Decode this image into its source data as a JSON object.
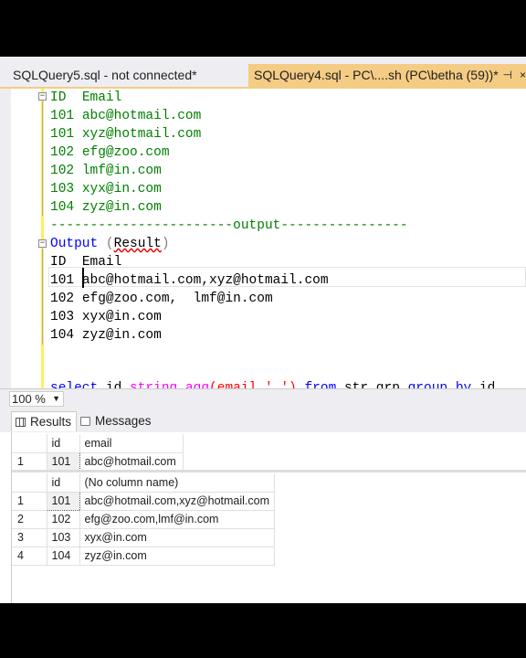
{
  "tabs": {
    "inactive_title": "SQLQuery5.sql - not connected*",
    "active_title": "SQLQuery4.sql - PC\\....sh (PC\\betha (59))*",
    "pin_icon": "pin-icon",
    "close_icon": "close-icon"
  },
  "editor": {
    "lines": [
      {
        "id": "ID",
        "email": "Email"
      },
      {
        "id": "101",
        "email": "abc@hotmail.com"
      },
      {
        "id": "101",
        "email": "xyz@hotmail.com"
      },
      {
        "id": "102",
        "email": "efg@zoo.com"
      },
      {
        "id": "102",
        "email": "lmf@in.com"
      },
      {
        "id": "103",
        "email": "xyx@in.com"
      },
      {
        "id": "104",
        "email": "zyz@in.com"
      }
    ],
    "separator_left": "-----------------------",
    "separator_word": "output",
    "separator_right": "----------------",
    "output_word": "Output",
    "output_paren_open": "(",
    "output_result": "Result",
    "output_paren_close": ")",
    "out_header": {
      "id": "ID",
      "email": "Email"
    },
    "out_lines": [
      {
        "id": "101",
        "email": "abc@hotmail.com,xyz@hotmail.com"
      },
      {
        "id": "102",
        "email": "efg@zoo.com,  lmf@in.com"
      },
      {
        "id": "103",
        "email": "xyx@in.com"
      },
      {
        "id": "104",
        "email": "zyz@in.com"
      }
    ],
    "query_select": "select",
    "query_cols": " id,",
    "query_fn": "string_agg",
    "query_args": "(email,',')",
    "query_from": " from",
    "query_table": " str_grp",
    "query_group": " group by",
    "query_tail": " id"
  },
  "zoom": {
    "value": "100 %"
  },
  "results_tabs": {
    "results": "Results",
    "messages": "Messages"
  },
  "grid1": {
    "headers": [
      "id",
      "email"
    ],
    "rows": [
      {
        "n": "1",
        "id": "101",
        "email": "abc@hotmail.com"
      }
    ]
  },
  "grid2": {
    "headers": [
      "id",
      "(No column name)"
    ],
    "rows": [
      {
        "n": "1",
        "id": "101",
        "val": "abc@hotmail.com,xyz@hotmail.com"
      },
      {
        "n": "2",
        "id": "102",
        "val": "efg@zoo.com,lmf@in.com"
      },
      {
        "n": "3",
        "id": "103",
        "val": "xyx@in.com"
      },
      {
        "n": "4",
        "id": "104",
        "val": "zyz@in.com"
      }
    ]
  },
  "colors": {
    "tab_active": "#f5cc84",
    "keyword": "#0000ff",
    "function": "#ff00ff",
    "string": "#ff0000",
    "comment": "#008000"
  }
}
